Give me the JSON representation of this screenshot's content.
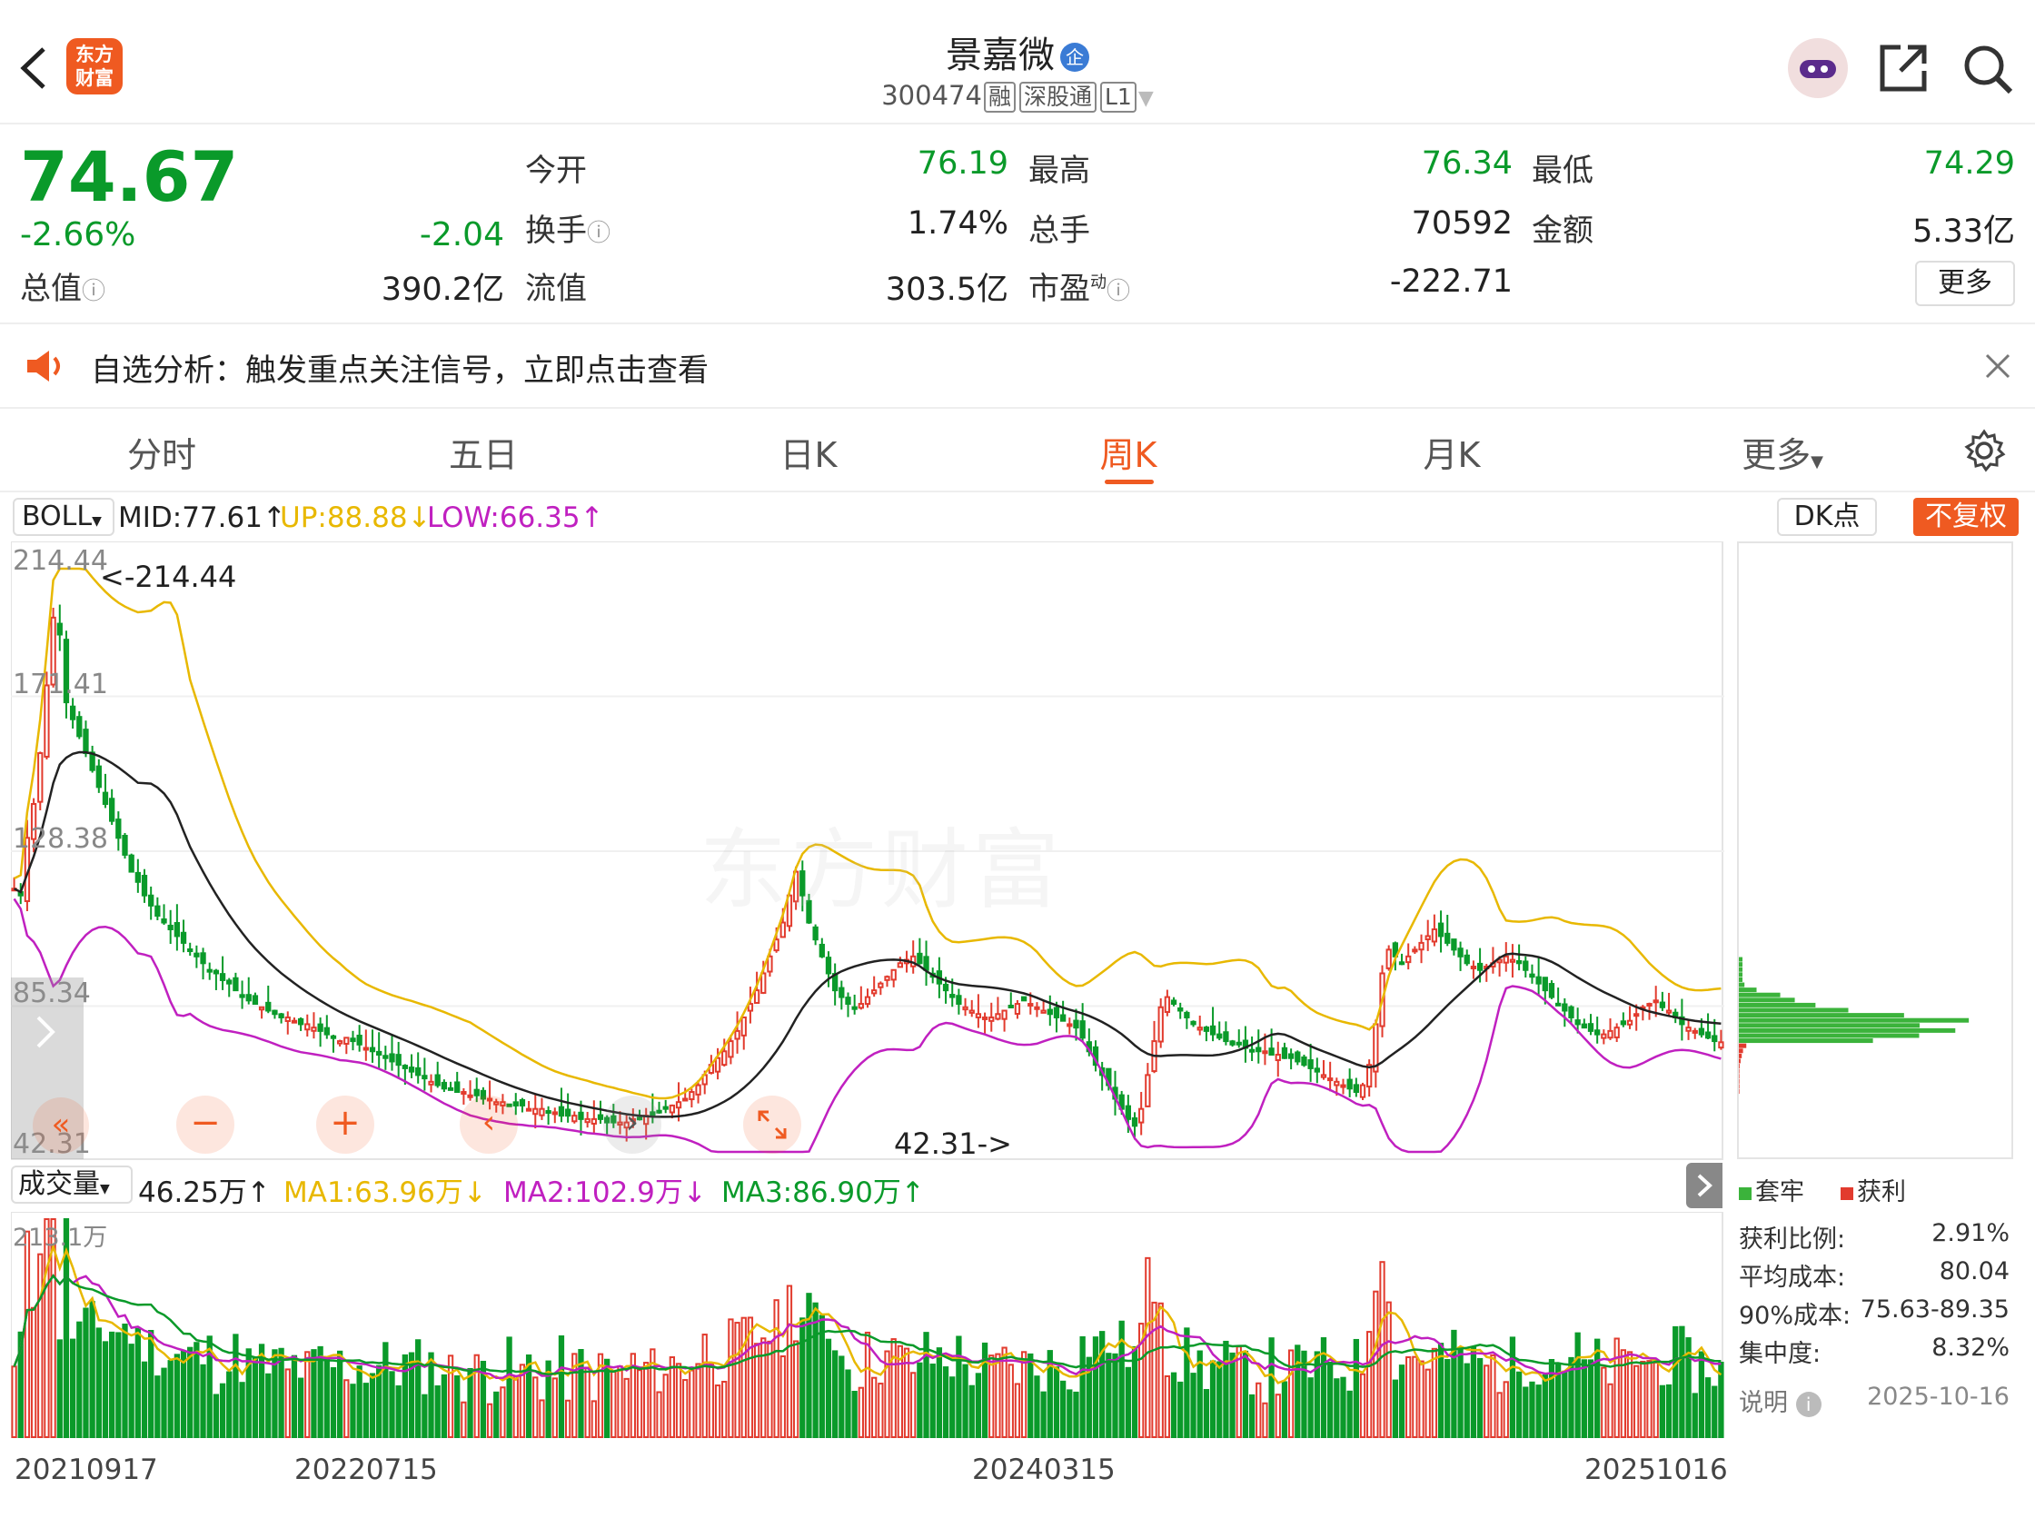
{
  "header": {
    "title": "景嘉微",
    "code": "300474",
    "tags": [
      "融",
      "深股通",
      "L1"
    ],
    "logo_text": "东方财富",
    "back_icon": "chevron-left-icon",
    "share_icon": "share-icon",
    "search_icon": "search-icon"
  },
  "quote": {
    "price": "74.67",
    "pct": "-2.66%",
    "chg": "-2.04",
    "open_label": "今开",
    "open": "76.19",
    "high_label": "最高",
    "high": "76.34",
    "low_label": "最低",
    "low": "74.29",
    "turnover_label": "换手",
    "turnover": "1.74%",
    "vol_label": "总手",
    "vol": "70592",
    "amount_label": "金额",
    "amount": "5.33亿",
    "mcap_label": "总值",
    "mcap": "390.2亿",
    "float_label": "流值",
    "float": "303.5亿",
    "pe_label": "市盈",
    "pe_sup": "动",
    "pe": "-222.71",
    "more": "更多"
  },
  "notice": {
    "text": "自选分析：触发重点关注信号，立即点击查看"
  },
  "tabs": [
    "分时",
    "五日",
    "日K",
    "周K",
    "月K",
    "更多"
  ],
  "active_tab": 3,
  "indicator": {
    "name": "BOLL",
    "mid": "MID:77.61↑",
    "up": "UP:88.88↓",
    "low": "LOW:66.35↑",
    "dk": "DK点",
    "fq": "不复权"
  },
  "price_axis": [
    "214.44",
    "171.41",
    "128.38",
    "85.34",
    "42.31"
  ],
  "annot": {
    "high": "<-214.44",
    "low": "42.31->"
  },
  "watermark": "东方财富",
  "volume": {
    "name": "成交量",
    "vol": "46.25万↑",
    "ma1": "MA1:63.96万↓",
    "ma2": "MA2:102.9万↓",
    "ma3": "MA3:86.90万↑",
    "axis_top": "213.1万"
  },
  "dates": [
    "20210917",
    "20220715",
    "20240315",
    "20251016"
  ],
  "chip": {
    "legend_a": "套牢",
    "legend_b": "获利",
    "rows": [
      {
        "k": "获利比例:",
        "v": "2.91%"
      },
      {
        "k": "平均成本:",
        "v": "80.04"
      },
      {
        "k": "90%成本:",
        "v": "75.63-89.35"
      },
      {
        "k": "集中度:",
        "v": "8.32%"
      }
    ],
    "note": "说明",
    "date": "2025-10-16"
  },
  "colors": {
    "up": "#e23b2e",
    "down": "#0a9a2a",
    "accent": "#ef5a21",
    "mid": "#222222",
    "upper": "#e8b800",
    "lower": "#c020c0"
  },
  "chart_data": {
    "type": "candlestick",
    "x_first": "20210917",
    "x_last": "20251016",
    "ylim": [
      42.31,
      214.44
    ],
    "closes": [
      120,
      118,
      135,
      145,
      160,
      180,
      200,
      195,
      175,
      170,
      165,
      160,
      155,
      150,
      145,
      140,
      135,
      130,
      125,
      122,
      118,
      115,
      112,
      110,
      108,
      106,
      104,
      102,
      100,
      98,
      96,
      95,
      93,
      92,
      90,
      88,
      87,
      86,
      85,
      84,
      83,
      82,
      82,
      81,
      80,
      80,
      79,
      78,
      77,
      76,
      75,
      76,
      75,
      74,
      73,
      72,
      71,
      70,
      69,
      68,
      67,
      66,
      65,
      64,
      63,
      62,
      61,
      61,
      60,
      60,
      59,
      59,
      58,
      58,
      57,
      57,
      56,
      56,
      56,
      55,
      55,
      55,
      54,
      54,
      53,
      53,
      53,
      52,
      52,
      52,
      52,
      51,
      51,
      51,
      51,
      52,
      52,
      53,
      53,
      54,
      55,
      56,
      57,
      58,
      60,
      62,
      65,
      68,
      70,
      72,
      75,
      78,
      82,
      86,
      90,
      95,
      100,
      105,
      110,
      118,
      125,
      118,
      110,
      105,
      100,
      95,
      90,
      88,
      86,
      85,
      86,
      88,
      90,
      92,
      94,
      96,
      98,
      99,
      100,
      98,
      96,
      94,
      92,
      90,
      88,
      86,
      85,
      84,
      83,
      82,
      82,
      83,
      84,
      85,
      86,
      87,
      86,
      85,
      84,
      83,
      82,
      81,
      80,
      79,
      76,
      72,
      68,
      65,
      62,
      58,
      55,
      52,
      50,
      55,
      65,
      75,
      85,
      88,
      86,
      84,
      82,
      80,
      79,
      78,
      77,
      76,
      75,
      74,
      74,
      73,
      72,
      72,
      72,
      71,
      71,
      70,
      70,
      69,
      68,
      67,
      66,
      65,
      64,
      63,
      62,
      61,
      60,
      62,
      68,
      80,
      95,
      102,
      100,
      98,
      100,
      102,
      104,
      106,
      108,
      106,
      104,
      102,
      100,
      98,
      97,
      96,
      97,
      98,
      99,
      100,
      99,
      98,
      96,
      94,
      92,
      90,
      88,
      86,
      84,
      82,
      80,
      79,
      78,
      77,
      77,
      78,
      79,
      80,
      81,
      83,
      85,
      86,
      87,
      85,
      84,
      82,
      80,
      79,
      78,
      77,
      76,
      75,
      74.67
    ]
  }
}
